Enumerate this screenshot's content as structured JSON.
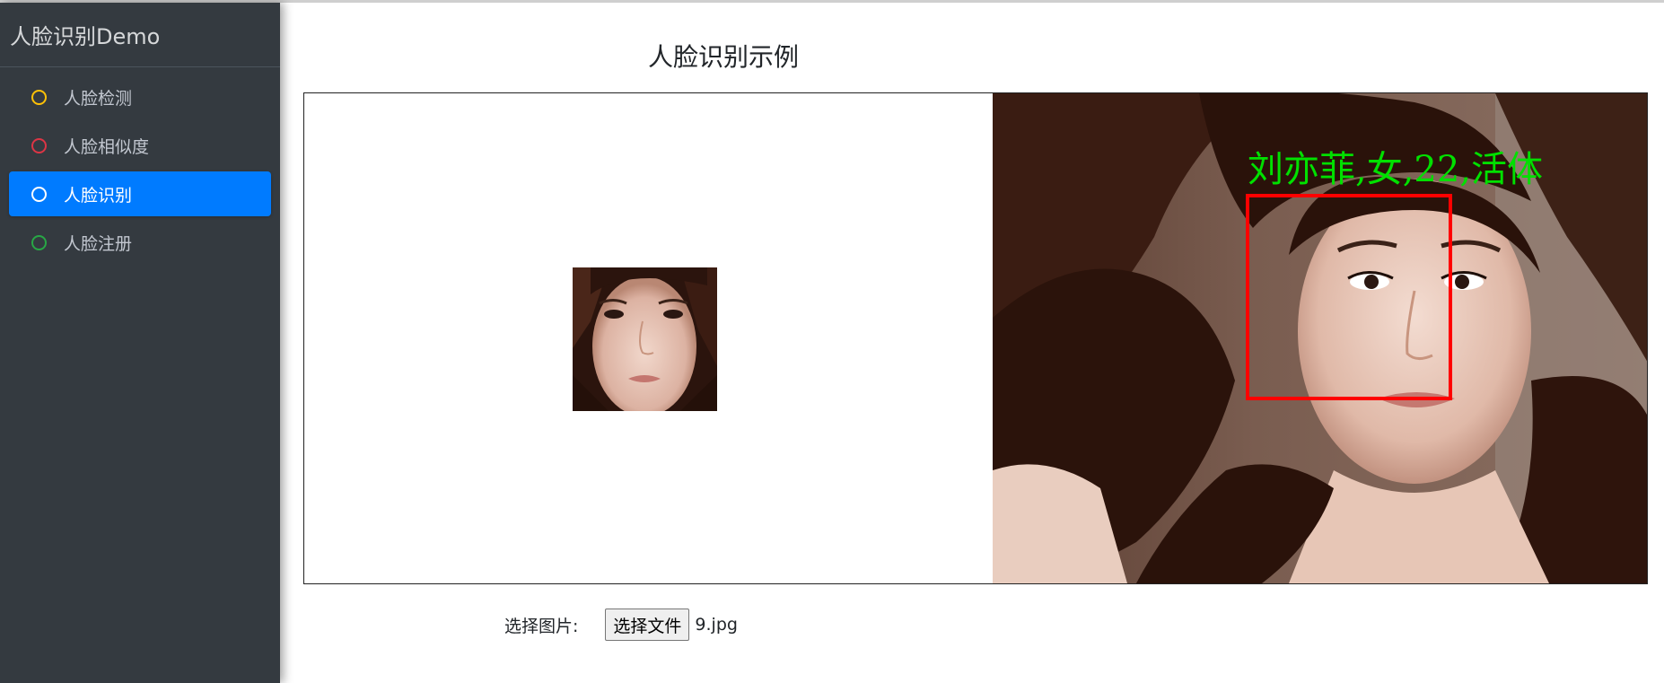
{
  "sidebar": {
    "brand": "人脸识别Demo",
    "items": [
      {
        "label": "人脸检测",
        "ring_color": "#ffc107",
        "active": false
      },
      {
        "label": "人脸相似度",
        "ring_color": "#dc3545",
        "active": false
      },
      {
        "label": "人脸识别",
        "ring_color": "#ffffff",
        "active": true
      },
      {
        "label": "人脸注册",
        "ring_color": "#28a745",
        "active": false
      }
    ]
  },
  "main": {
    "title": "人脸识别示例",
    "result_label": "刘亦菲,女,22,活体",
    "file_input": {
      "label": "选择图片:",
      "button_label": "选择文件",
      "file_name": "9.jpg"
    }
  },
  "colors": {
    "sidebar_bg": "#343a40",
    "active_bg": "#007bff",
    "detect_box": "#ff0000",
    "result_text": "#00e000"
  }
}
